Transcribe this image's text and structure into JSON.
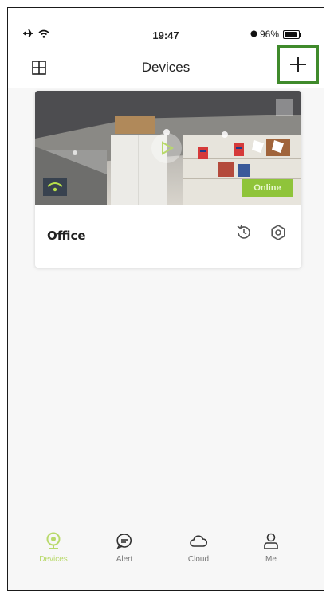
{
  "status": {
    "time": "19:47",
    "battery": "96%"
  },
  "nav": {
    "title": "Devices"
  },
  "devices": [
    {
      "name": "Office",
      "status": "Online"
    }
  ],
  "tabs": [
    {
      "label": "Devices",
      "icon": "camera-icon",
      "active": true
    },
    {
      "label": "Alert",
      "icon": "chat-bubble-icon",
      "active": false
    },
    {
      "label": "Cloud",
      "icon": "cloud-icon",
      "active": false
    },
    {
      "label": "Me",
      "icon": "person-icon",
      "active": false
    }
  ],
  "colors": {
    "accent": "#b8d96a",
    "online_badge": "#8fc43a",
    "highlight_border": "#3f8a2b"
  }
}
